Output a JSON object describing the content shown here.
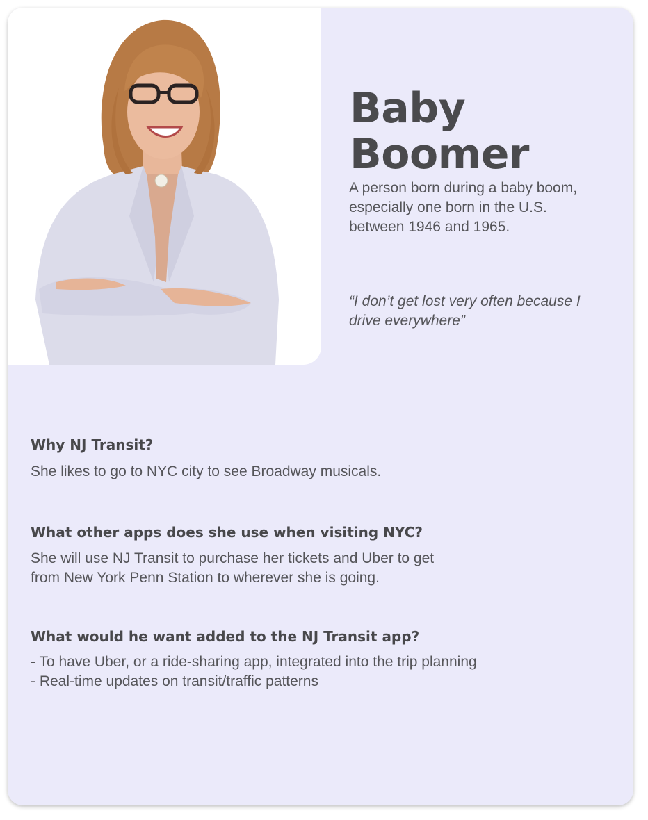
{
  "persona": {
    "title": "Baby\nBoomer",
    "definition": "A person born during a baby boom, especially one born in the U.S. between 1946 and 1965.",
    "quote": "“I don’t get lost very often because I drive everywhere”"
  },
  "sections": [
    {
      "heading": "Why NJ Transit?",
      "body": "She likes to go to NYC city to see Broadway musicals."
    },
    {
      "heading": "What other apps does she use when visiting NYC?",
      "body": "She will use NJ Transit to purchase her tickets and Uber to get\nfrom New York Penn Station to wherever she is going."
    },
    {
      "heading": "What would he want added to the NJ Transit app?",
      "body": "- To have Uber, or a ride-sharing app, integrated into the trip planning\n- Real-time updates on transit/traffic patterns"
    }
  ],
  "colors": {
    "card_background": "#ebeafa",
    "heading_text": "#4a4a4d",
    "body_text": "#555559"
  }
}
